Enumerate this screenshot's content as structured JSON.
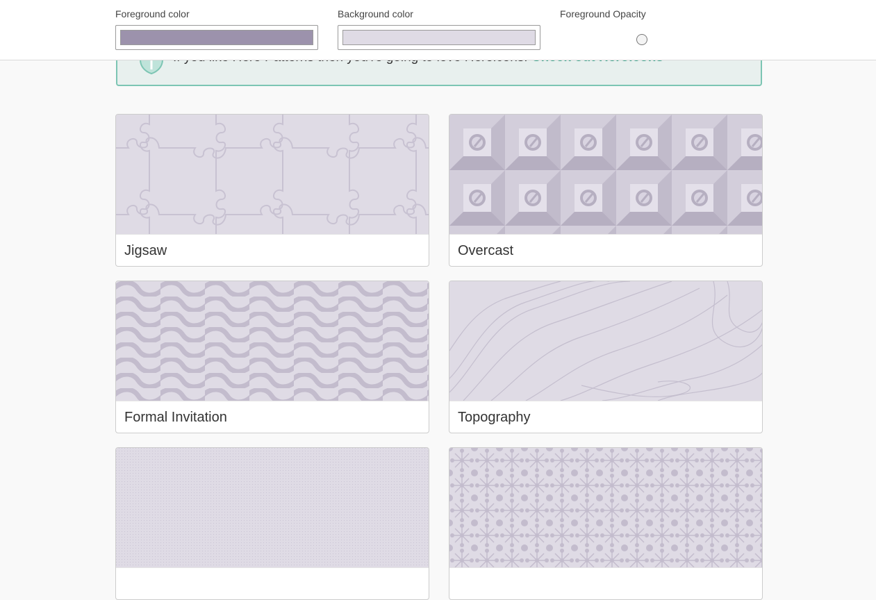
{
  "controls": {
    "foreground_label": "Foreground color",
    "background_label": "Background color",
    "opacity_label": "Foreground Opacity",
    "foreground_color": "#9c92ac",
    "background_color": "#dfdbe5"
  },
  "banner": {
    "text": "If you like Hero Patterns then you're going to love Heroicons.",
    "link_text": "Check out Heroicons",
    "accent_color": "#7cc5b3",
    "icon": "heroicons-shield-icon"
  },
  "patterns": [
    {
      "name": "Jigsaw"
    },
    {
      "name": "Overcast"
    },
    {
      "name": "Formal Invitation"
    },
    {
      "name": "Topography"
    },
    {
      "name": ""
    },
    {
      "name": ""
    }
  ]
}
